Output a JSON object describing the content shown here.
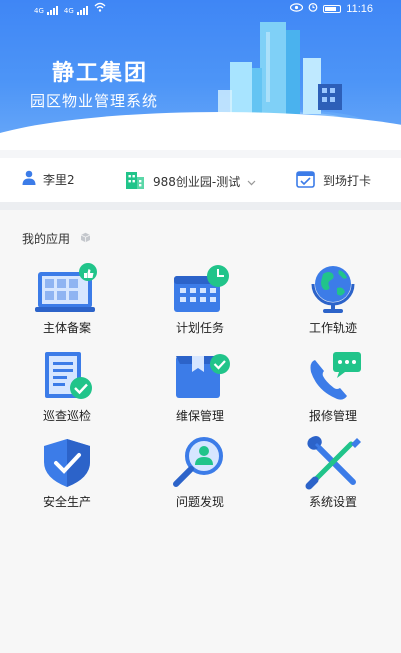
{
  "status_bar": {
    "network_labels": [
      "4G",
      "4G"
    ],
    "time": "11:16"
  },
  "header": {
    "title": "静工集团",
    "subtitle": "园区物业管理系统"
  },
  "info_bar": {
    "user_name": "李里2",
    "park_name": "988创业园-测试",
    "checkin_label": "到场打卡"
  },
  "apps": {
    "section_title": "我的应用",
    "items": [
      {
        "label": "主体备案",
        "icon": "subject-filing-icon"
      },
      {
        "label": "计划任务",
        "icon": "calendar-clock-icon"
      },
      {
        "label": "工作轨迹",
        "icon": "globe-icon"
      },
      {
        "label": "巡查巡检",
        "icon": "checklist-icon"
      },
      {
        "label": "维保管理",
        "icon": "package-check-icon"
      },
      {
        "label": "报修管理",
        "icon": "phone-chat-icon"
      },
      {
        "label": "安全生产",
        "icon": "shield-check-icon"
      },
      {
        "label": "问题发现",
        "icon": "search-person-icon"
      },
      {
        "label": "系统设置",
        "icon": "wrench-screwdriver-icon"
      }
    ]
  },
  "colors": {
    "primary": "#3f86f5",
    "accent_green": "#21c48a",
    "icon_blue": "#3c7ce8"
  }
}
